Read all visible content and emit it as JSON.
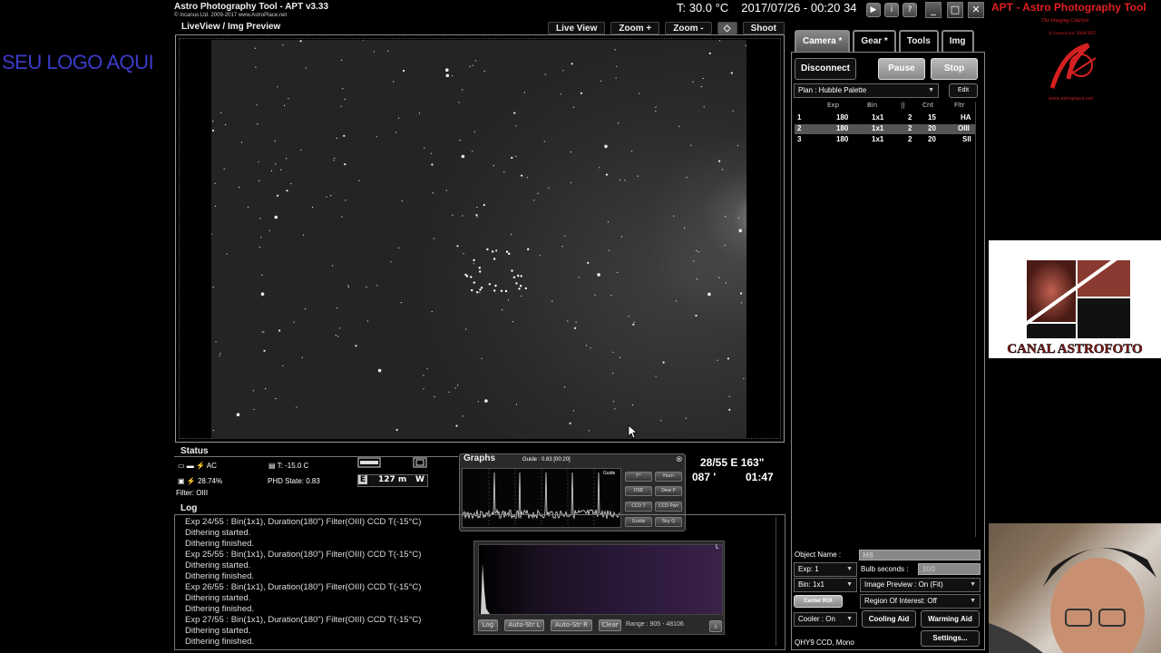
{
  "overlay": {
    "logo_placeholder": "SEU LOGO AQUI"
  },
  "app": {
    "title": "Astro Photography Tool  -  APT v3.33",
    "subtitle": "© Incanus Ltd. 2009-2017  www.AstroPlace.net",
    "temperature": "T: 30.0 °C",
    "datetime": "2017/07/26 - 00:20 34",
    "brand_title": "APT - Astro Photography Tool",
    "brand_tagline": "The Imaging Catalyst",
    "brand_copy": "© Incanus Ltd. 2009-2017",
    "brand_url": "www.astroplace.net",
    "window_buttons": [
      "▶",
      "i",
      "?"
    ],
    "min_label": "_",
    "max_label": "□",
    "close_label": "✕"
  },
  "preview": {
    "label": "LiveView / Img Preview",
    "tabs": [
      "Live View",
      "Zoom +",
      "Zoom -",
      "Shoot"
    ]
  },
  "right_panel": {
    "tabs": [
      "Camera *",
      "Gear *",
      "Tools",
      "Img"
    ],
    "disconnect": "Disconnect",
    "pause": "Pause",
    "stop": "Stop",
    "plan_select": "Plan : Hubble Palette",
    "edit": "Edit",
    "plan_columns": [
      "Exp",
      "Bin",
      "||",
      "Cnt",
      "Fltr"
    ],
    "plan_rows": [
      {
        "num": "1",
        "exp": "180",
        "bin": "1x1",
        "pause": "2",
        "cnt": "15",
        "fltr": "HA"
      },
      {
        "num": "2",
        "exp": "180",
        "bin": "1x1",
        "pause": "2",
        "cnt": "20",
        "fltr": "OIII"
      },
      {
        "num": "3",
        "exp": "180",
        "bin": "1x1",
        "pause": "2",
        "cnt": "20",
        "fltr": "SII"
      }
    ],
    "object_name_label": "Object Name :",
    "object_name_value": "M8",
    "exp_select": "Exp: 1",
    "bulb_label": "Bulb seconds :",
    "bulb_value": "300",
    "bin_select": "Bin: 1x1",
    "image_preview_select": "Image Preview : On (Fit)",
    "center_roi": "Center ROI",
    "roi_select": "Region Of Interest: Off",
    "cooler_select": "Cooler : On",
    "cooling_aid": "Cooling Aid",
    "warming_aid": "Warming Aid",
    "camera_name": "QHY9 CCD, Mono",
    "settings": "Settings..."
  },
  "status": {
    "label": "Status",
    "ac": "AC",
    "battery": "28.74%",
    "filter": "Filter: OIII",
    "ccd_temp": "T:  -15.0 C",
    "phd_state": "PHD State: 0.83",
    "focuser_e": "E",
    "focuser_value": "127 m",
    "focuser_w": "W"
  },
  "mount": {
    "line1": "28/55 E 163\"",
    "pos2": "087 '",
    "time2": "01:47"
  },
  "graphs": {
    "label": "Graphs",
    "guide": "Guide : 0.83 [00:20]",
    "guide_tag": "Guide",
    "buttons": [
      "T°",
      "Hum",
      "DSE",
      "Dew P",
      "CCD T",
      "CCD Pwr",
      "Guide",
      "Sky Q"
    ]
  },
  "log": {
    "label": "Log",
    "lines": [
      "Exp 24/55 : Bin(1x1), Duration(180\") Filter(OIII) CCD T(-15°C)",
      "Dithering started.",
      "Dithering finished.",
      "Exp 25/55 : Bin(1x1), Duration(180\") Filter(OIII) CCD T(-15°C)",
      "Dithering started.",
      "Dithering finished.",
      "Exp 26/55 : Bin(1x1), Duration(180\") Filter(OIII) CCD T(-15°C)",
      "Dithering started.",
      "Dithering finished.",
      "Exp 27/55 : Bin(1x1), Duration(180\") Filter(OIII) CCD T(-15°C)",
      "Dithering started.",
      "Dithering finished."
    ]
  },
  "histogram": {
    "corner": "L",
    "log": "Log",
    "auto_l": "Auto-Str L",
    "auto_r": "Auto-Str R",
    "clear": "Clear",
    "range": "Range : 905 - 48106"
  },
  "canal": {
    "name": "CANAL ASTROFOTO"
  }
}
